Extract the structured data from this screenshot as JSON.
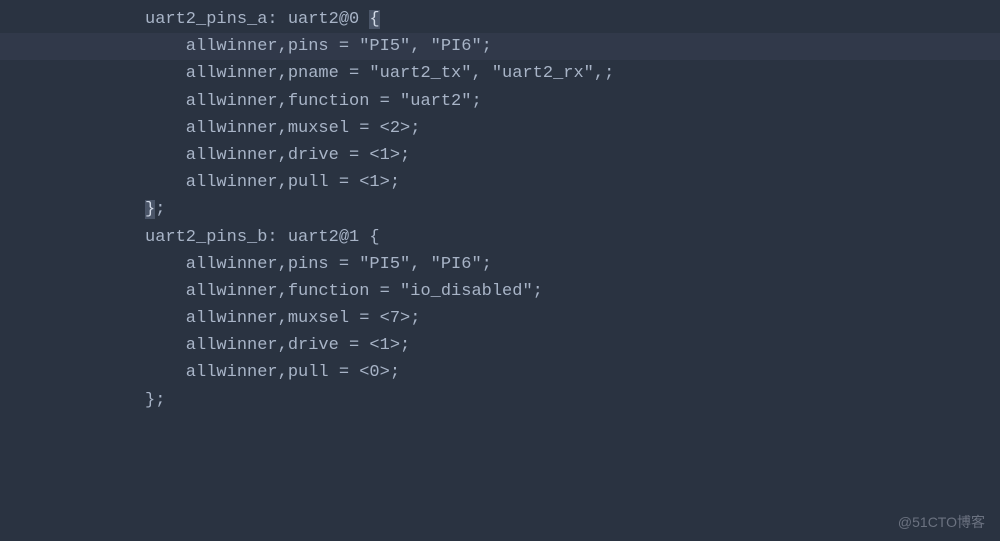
{
  "code": {
    "block1": {
      "label_declaration": "uart2_pins_a: uart2@0 ",
      "open_brace": "{",
      "line1": "    allwinner,pins = \"PI5\", \"PI6\";",
      "line2": "    allwinner,pname = \"uart2_tx\", \"uart2_rx\",;",
      "line3": "    allwinner,function = \"uart2\";",
      "line4": "    allwinner,muxsel = <2>;",
      "line5": "    allwinner,drive = <1>;",
      "line6": "    allwinner,pull = <1>;",
      "close": "};"
    },
    "blank": "",
    "block2": {
      "label_declaration": "uart2_pins_b: uart2@1 {",
      "line1": "    allwinner,pins = \"PI5\", \"PI6\";",
      "line2": "    allwinner,function = \"io_disabled\";",
      "line3": "    allwinner,muxsel = <7>;",
      "line4": "    allwinner,drive = <1>;",
      "line5": "    allwinner,pull = <0>;",
      "close": "};"
    }
  },
  "watermark": "@51CTO博客"
}
